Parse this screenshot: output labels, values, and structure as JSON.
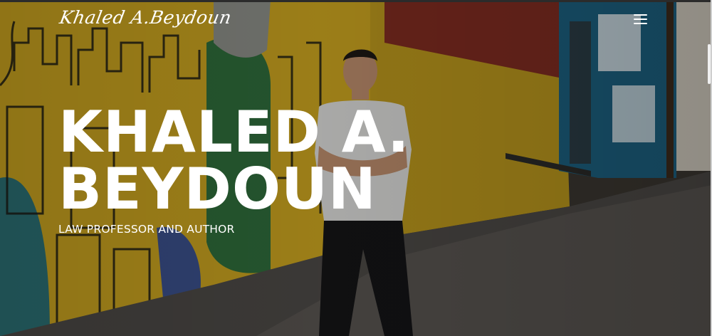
{
  "header": {
    "logo_text": "Khaled A.Beydoun",
    "menu_icon": "hamburger-icon"
  },
  "hero": {
    "title_line1": "KHALED A.",
    "title_line2": "BEYDOUN",
    "subtitle": "LAW PROFESSOR AND AUTHOR",
    "background": "photo of a man in a white t-shirt and black jeans standing with crossed arms on a cobblestone street beside a yellow wall with black-line cityscape murals and a blue building"
  },
  "colors": {
    "text": "#ffffff",
    "wall_yellow": "#c9a41e",
    "building_blue": "#1f6f8f",
    "wall_red_band": "#8a2e22",
    "cobblestone": "#4a4846"
  }
}
